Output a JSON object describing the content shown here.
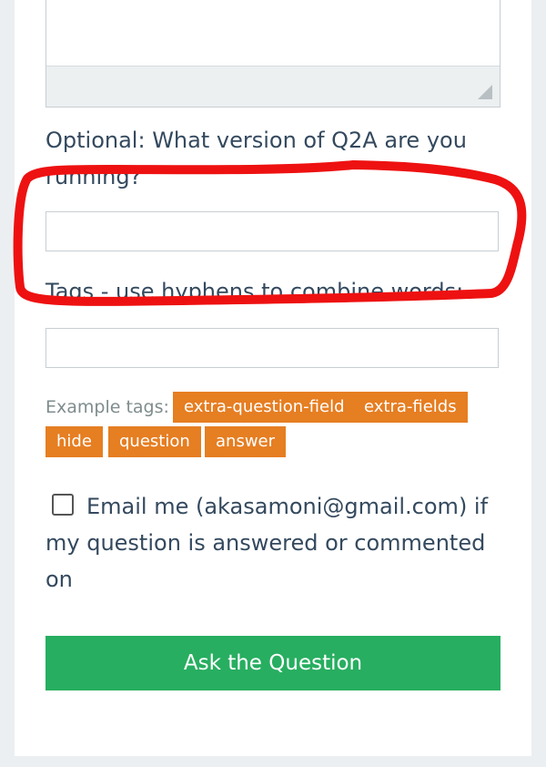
{
  "form": {
    "question_textarea_value": "",
    "version_label": "Optional: What version of Q2A are you running?",
    "version_value": "",
    "tags_label": "Tags - use hyphens to combine words:",
    "tags_value": "",
    "example_tags_label": "Example tags:",
    "example_tags": [
      "extra-question-field",
      "extra-fields",
      "hide",
      "question",
      "answer"
    ],
    "email_notify_checked": false,
    "email_notify_label": "Email me (akasamoni@gmail.com) if my question is answered or commented on",
    "submit_label": "Ask the Question"
  },
  "colors": {
    "tag_background": "#e67e22",
    "submit_background": "#27ae60",
    "annotation_stroke": "#ee1111"
  },
  "annotation": {
    "shape": "hand-drawn-outline",
    "encircles": "version field"
  }
}
